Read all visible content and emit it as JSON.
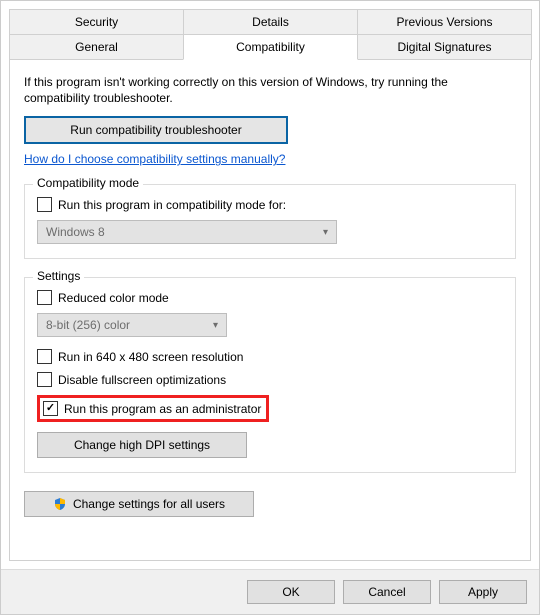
{
  "tabs": {
    "row1": [
      "Security",
      "Details",
      "Previous Versions"
    ],
    "row2": [
      "General",
      "Compatibility",
      "Digital Signatures"
    ],
    "active": "Compatibility"
  },
  "intro": "If this program isn't working correctly on this version of Windows, try running the compatibility troubleshooter.",
  "run_troubleshooter": "Run compatibility troubleshooter",
  "help_link": "How do I choose compatibility settings manually?",
  "compat_mode": {
    "legend": "Compatibility mode",
    "checkbox_label": "Run this program in compatibility mode for:",
    "select_value": "Windows 8"
  },
  "settings": {
    "legend": "Settings",
    "reduced_color": "Reduced color mode",
    "color_select": "8-bit (256) color",
    "run640": "Run in 640 x 480 screen resolution",
    "disable_fullscreen": "Disable fullscreen optimizations",
    "run_admin": "Run this program as an administrator",
    "change_dpi": "Change high DPI settings"
  },
  "change_all_users": "Change settings for all users",
  "footer": {
    "ok": "OK",
    "cancel": "Cancel",
    "apply": "Apply"
  }
}
